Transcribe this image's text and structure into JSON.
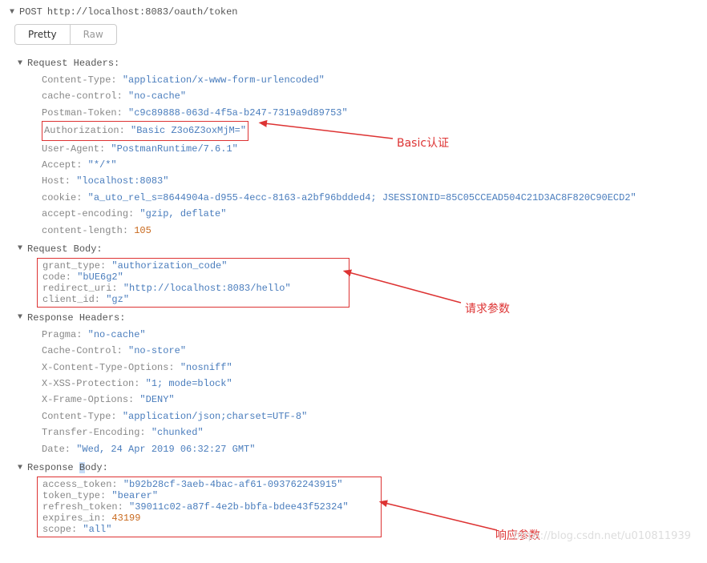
{
  "request": {
    "method": "POST",
    "url": "http://localhost:8083/oauth/token"
  },
  "tabs": {
    "pretty": "Pretty",
    "raw": "Raw"
  },
  "sections": {
    "reqHeaders": "Request Headers:",
    "reqBody": "Request Body:",
    "resHeaders": "Response Headers:",
    "resBody": "Response Body:"
  },
  "reqHeaders": {
    "ContentType": {
      "k": "Content-Type:",
      "v": "\"application/x-www-form-urlencoded\""
    },
    "cacheControl": {
      "k": "cache-control:",
      "v": "\"no-cache\""
    },
    "PostmanToken": {
      "k": "Postman-Token:",
      "v": "\"c9c89888-063d-4f5a-b247-7319a9d89753\""
    },
    "Authorization": {
      "k": "Authorization:",
      "v": "\"Basic Z3o6Z3oxMjM=\""
    },
    "UserAgent": {
      "k": "User-Agent:",
      "v": "\"PostmanRuntime/7.6.1\""
    },
    "Accept": {
      "k": "Accept:",
      "v": "\"*/*\""
    },
    "Host": {
      "k": "Host:",
      "v": "\"localhost:8083\""
    },
    "cookie": {
      "k": "cookie:",
      "v": "\"a_uto_rel_s=8644904a-d955-4ecc-8163-a2bf96bdded4; JSESSIONID=85C05CCEAD504C21D3AC8F820C90ECD2\""
    },
    "acceptEncoding": {
      "k": "accept-encoding:",
      "v": "\"gzip, deflate\""
    },
    "contentLength": {
      "k": "content-length:",
      "v": "105"
    }
  },
  "reqBody": {
    "grant_type": {
      "k": "grant_type:",
      "v": "\"authorization_code\""
    },
    "code": {
      "k": "code:",
      "v": "\"bUE6g2\""
    },
    "redirect_uri": {
      "k": "redirect_uri:",
      "v": "\"http://localhost:8083/hello\""
    },
    "client_id": {
      "k": "client_id:",
      "v": "\"gz\""
    }
  },
  "resHeaders": {
    "Pragma": {
      "k": "Pragma:",
      "v": "\"no-cache\""
    },
    "CacheControl": {
      "k": "Cache-Control:",
      "v": "\"no-store\""
    },
    "XContentTypeOptions": {
      "k": "X-Content-Type-Options:",
      "v": "\"nosniff\""
    },
    "XXSSProtection": {
      "k": "X-XSS-Protection:",
      "v": "\"1; mode=block\""
    },
    "XFrameOptions": {
      "k": "X-Frame-Options:",
      "v": "\"DENY\""
    },
    "ContentType": {
      "k": "Content-Type:",
      "v": "\"application/json;charset=UTF-8\""
    },
    "TransferEncoding": {
      "k": "Transfer-Encoding:",
      "v": "\"chunked\""
    },
    "Date": {
      "k": "Date:",
      "v": "\"Wed, 24 Apr 2019 06:32:27 GMT\""
    }
  },
  "resBody": {
    "access_token": {
      "k": "access_token:",
      "v": "\"b92b28cf-3aeb-4bac-af61-093762243915\""
    },
    "token_type": {
      "k": "token_type:",
      "v": "\"bearer\""
    },
    "refresh_token": {
      "k": "refresh_token:",
      "v": "\"39011c02-a87f-4e2b-bbfa-bdee43f52324\""
    },
    "expires_in": {
      "k": "expires_in:",
      "v": "43199"
    },
    "scope": {
      "k": "scope:",
      "v": "\"all\""
    }
  },
  "resBodyLabel": {
    "pre": "Response ",
    "mid": "B",
    "post": "ody:"
  },
  "annotations": {
    "basic": "Basic认证",
    "reqParams": "请求参数",
    "resParams": "响应参数"
  },
  "watermark": "https://blog.csdn.net/u010811939"
}
